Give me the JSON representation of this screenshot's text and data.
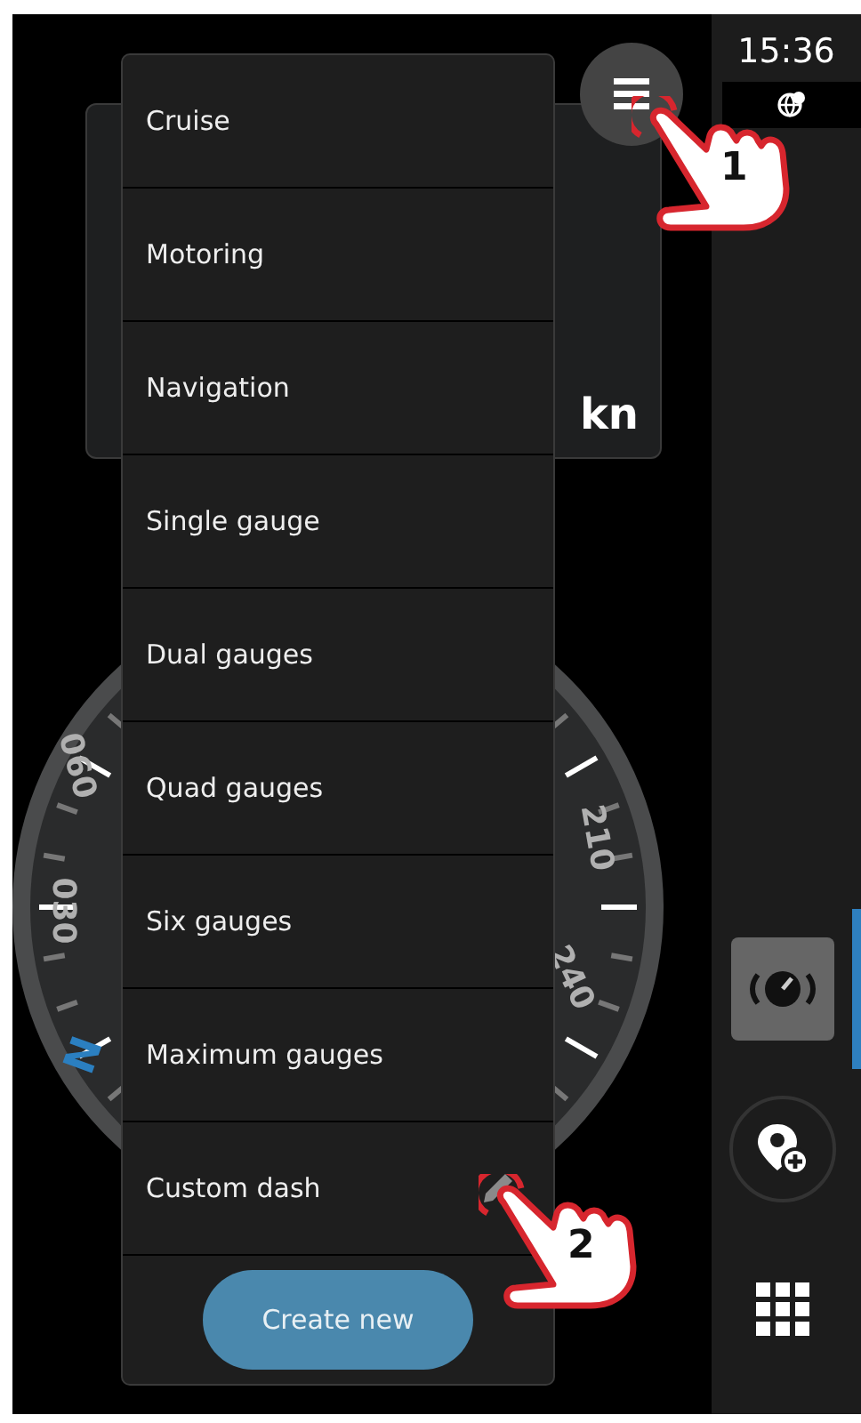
{
  "status_bar": {
    "time": "15:36"
  },
  "speed_card": {
    "unit": "kn"
  },
  "compass": {
    "labels": [
      {
        "text": "060",
        "kind": "bearing"
      },
      {
        "text": "030",
        "kind": "bearing"
      },
      {
        "text": "N",
        "kind": "north"
      },
      {
        "text": "210",
        "kind": "bearing"
      },
      {
        "text": "240",
        "kind": "bearing"
      }
    ]
  },
  "menu": {
    "items": [
      {
        "label": "Cruise",
        "editable": false
      },
      {
        "label": "Motoring",
        "editable": false
      },
      {
        "label": "Navigation",
        "editable": false
      },
      {
        "label": "Single gauge",
        "editable": false
      },
      {
        "label": "Dual gauges",
        "editable": false
      },
      {
        "label": "Quad gauges",
        "editable": false
      },
      {
        "label": "Six gauges",
        "editable": false
      },
      {
        "label": "Maximum gauges",
        "editable": false
      },
      {
        "label": "Custom dash",
        "editable": true
      }
    ],
    "create_button": "Create new"
  },
  "sidebar": {
    "items": [
      {
        "kind": "dashboard",
        "selected": true
      },
      {
        "kind": "add-waypoint",
        "selected": false
      },
      {
        "kind": "apps",
        "selected": false
      }
    ]
  },
  "callouts": [
    {
      "number": "1"
    },
    {
      "number": "2"
    }
  ]
}
